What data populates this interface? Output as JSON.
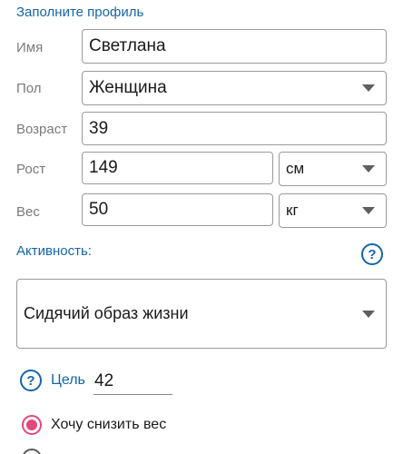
{
  "form": {
    "title": "Заполните профиль",
    "name": {
      "label": "Имя",
      "value": "Светлана"
    },
    "gender": {
      "label": "Пол",
      "value": "Женщина"
    },
    "age": {
      "label": "Возраст",
      "value": "39"
    },
    "height": {
      "label": "Рост",
      "value": "149",
      "unit": "см"
    },
    "weight": {
      "label": "Вес",
      "value": "50",
      "unit": "кг"
    },
    "activity": {
      "label": "Активность:",
      "value": "Сидячий образ жизни",
      "help": "?"
    },
    "goal": {
      "label": "Цель",
      "value": "42",
      "help": "?"
    },
    "target": {
      "options": [
        {
          "label": "Хочу снизить вес",
          "selected": true
        }
      ]
    }
  },
  "colors": {
    "accent": "#1565a8",
    "radio": "#e2487a"
  },
  "icons": {
    "dropdown": "chevron-down-icon",
    "help": "help-circle-icon"
  }
}
